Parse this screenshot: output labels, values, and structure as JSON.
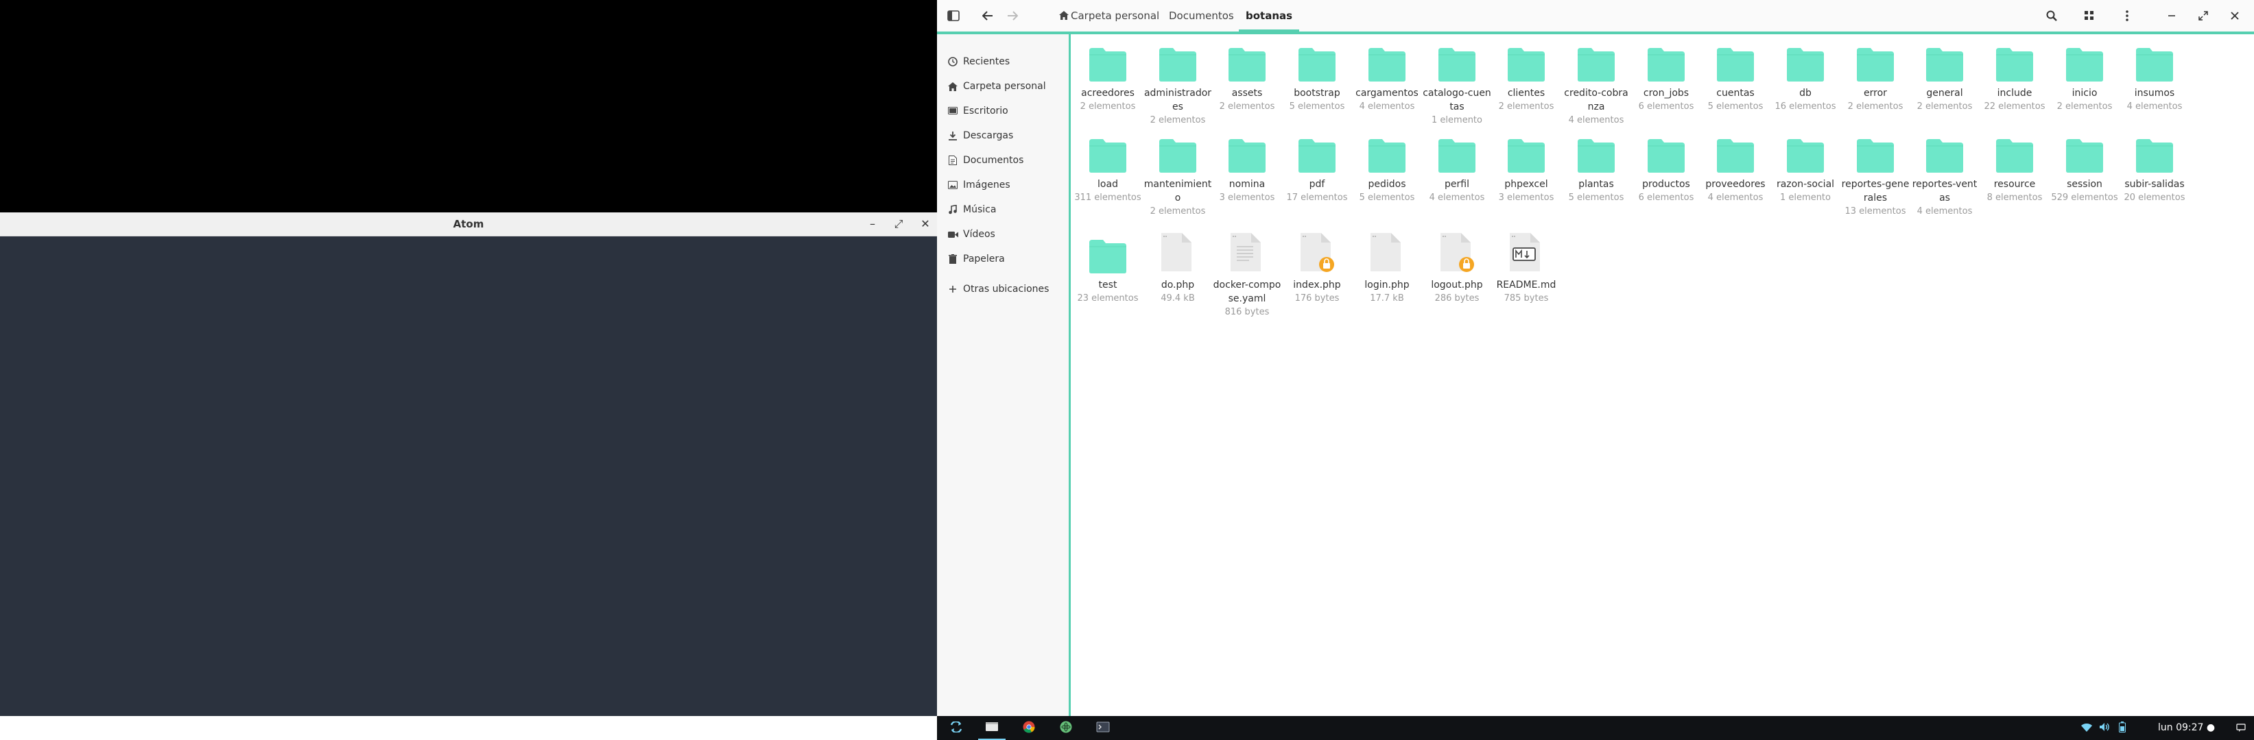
{
  "atom": {
    "title": "Atom",
    "controls": {
      "minimize": "–",
      "maximize": "⤢",
      "close": "✕"
    }
  },
  "files": {
    "breadcrumb": [
      "Carpeta personal",
      "Documentos",
      "botanas"
    ],
    "sidebar": [
      {
        "label": "Recientes",
        "icon": "clock-icon"
      },
      {
        "label": "Carpeta personal",
        "icon": "home-icon"
      },
      {
        "label": "Escritorio",
        "icon": "desktop-icon"
      },
      {
        "label": "Descargas",
        "icon": "download-icon"
      },
      {
        "label": "Documentos",
        "icon": "document-icon"
      },
      {
        "label": "Imágenes",
        "icon": "image-icon"
      },
      {
        "label": "Música",
        "icon": "music-icon"
      },
      {
        "label": "Vídeos",
        "icon": "video-icon"
      },
      {
        "label": "Papelera",
        "icon": "trash-icon"
      },
      {
        "label": "Otras ubicaciones",
        "icon": "plus-icon"
      }
    ],
    "items": [
      {
        "name": "acreedores",
        "meta": "2 elementos",
        "kind": "folder"
      },
      {
        "name": "administradores",
        "meta": "2 elementos",
        "kind": "folder"
      },
      {
        "name": "assets",
        "meta": "2 elementos",
        "kind": "folder"
      },
      {
        "name": "bootstrap",
        "meta": "5 elementos",
        "kind": "folder"
      },
      {
        "name": "cargamentos",
        "meta": "4 elementos",
        "kind": "folder"
      },
      {
        "name": "catalogo-cuentas",
        "meta": "1 elemento",
        "kind": "folder"
      },
      {
        "name": "clientes",
        "meta": "2 elementos",
        "kind": "folder"
      },
      {
        "name": "credito-cobranza",
        "meta": "4 elementos",
        "kind": "folder"
      },
      {
        "name": "cron_jobs",
        "meta": "6 elementos",
        "kind": "folder"
      },
      {
        "name": "cuentas",
        "meta": "5 elementos",
        "kind": "folder"
      },
      {
        "name": "db",
        "meta": "16 elementos",
        "kind": "folder"
      },
      {
        "name": "error",
        "meta": "2 elementos",
        "kind": "folder"
      },
      {
        "name": "general",
        "meta": "2 elementos",
        "kind": "folder"
      },
      {
        "name": "include",
        "meta": "22 elementos",
        "kind": "folder"
      },
      {
        "name": "inicio",
        "meta": "2 elementos",
        "kind": "folder"
      },
      {
        "name": "insumos",
        "meta": "4 elementos",
        "kind": "folder"
      },
      {
        "name": "load",
        "meta": "311 elementos",
        "kind": "folder"
      },
      {
        "name": "mantenimiento",
        "meta": "2 elementos",
        "kind": "folder"
      },
      {
        "name": "nomina",
        "meta": "3 elementos",
        "kind": "folder"
      },
      {
        "name": "pdf",
        "meta": "17 elementos",
        "kind": "folder"
      },
      {
        "name": "pedidos",
        "meta": "5 elementos",
        "kind": "folder"
      },
      {
        "name": "perfil",
        "meta": "4 elementos",
        "kind": "folder"
      },
      {
        "name": "phpexcel",
        "meta": "3 elementos",
        "kind": "folder"
      },
      {
        "name": "plantas",
        "meta": "5 elementos",
        "kind": "folder"
      },
      {
        "name": "productos",
        "meta": "6 elementos",
        "kind": "folder"
      },
      {
        "name": "proveedores",
        "meta": "4 elementos",
        "kind": "folder"
      },
      {
        "name": "razon-social",
        "meta": "1 elemento",
        "kind": "folder"
      },
      {
        "name": "reportes-generales",
        "meta": "13 elementos",
        "kind": "folder"
      },
      {
        "name": "reportes-ventas",
        "meta": "4 elementos",
        "kind": "folder"
      },
      {
        "name": "resource",
        "meta": "8 elementos",
        "kind": "folder"
      },
      {
        "name": "session",
        "meta": "529 elementos",
        "kind": "folder"
      },
      {
        "name": "subir-salidas",
        "meta": "20 elementos",
        "kind": "folder"
      },
      {
        "name": "test",
        "meta": "23 elementos",
        "kind": "folder"
      },
      {
        "name": "do.php",
        "meta": "49.4 kB",
        "kind": "file"
      },
      {
        "name": "docker-compose.yaml",
        "meta": "816 bytes",
        "kind": "text"
      },
      {
        "name": "index.php",
        "meta": "176 bytes",
        "kind": "locked"
      },
      {
        "name": "login.php",
        "meta": "17.7 kB",
        "kind": "file"
      },
      {
        "name": "logout.php",
        "meta": "286 bytes",
        "kind": "locked"
      },
      {
        "name": "README.md",
        "meta": "785 bytes",
        "kind": "markdown"
      }
    ]
  },
  "taskbar": {
    "apps": [
      "apps-icon",
      "files-icon",
      "chrome-icon",
      "atom-icon",
      "terminal-icon"
    ],
    "clock": "lun 09:27 ●"
  },
  "colors": {
    "accent": "#56cfb0",
    "folder": "#6ee7c9",
    "lock": "#f5a623"
  }
}
